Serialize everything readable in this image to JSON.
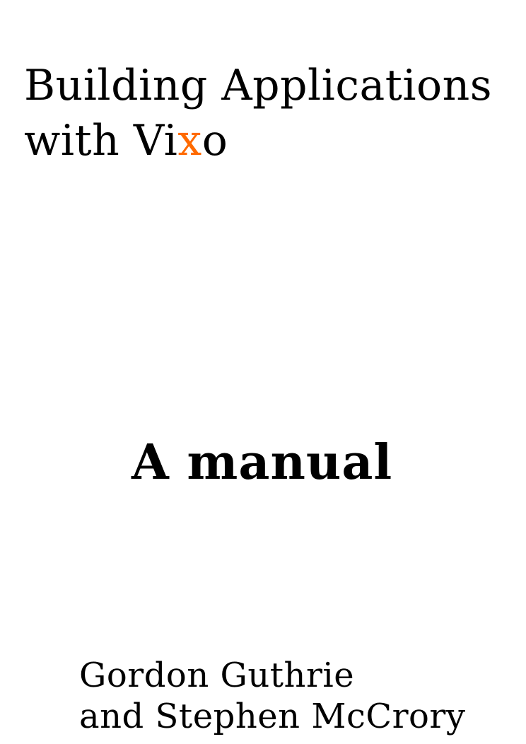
{
  "cover": {
    "title_line1": "Building Applications",
    "title_line2_prefix": "with Vi",
    "title_line2_accent": "x",
    "title_line2_suffix": "o",
    "subtitle": "A manual",
    "author_line1": "Gordon Guthrie",
    "author_line2": "and Stephen McCrory"
  },
  "colors": {
    "text": "#000000",
    "accent": "#ff6a00",
    "background": "#ffffff"
  }
}
